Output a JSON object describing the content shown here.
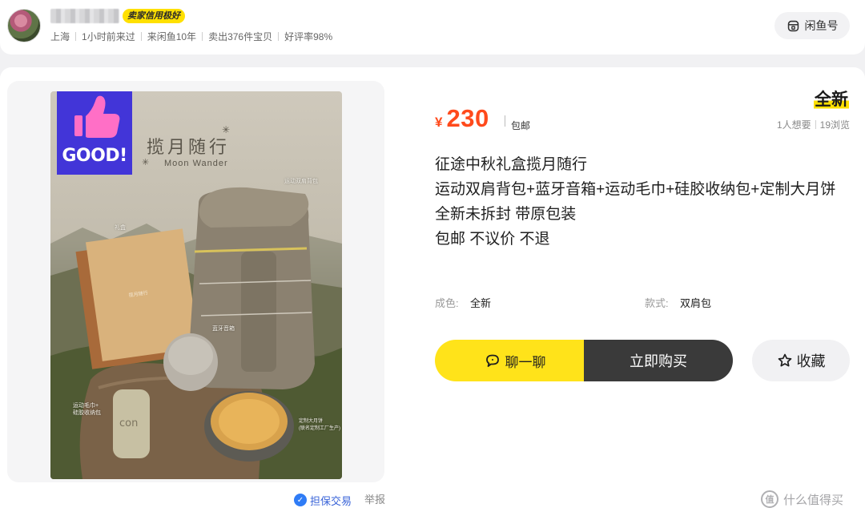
{
  "seller": {
    "credit_badge": "卖家信用极好",
    "location": "上海",
    "last_seen": "1小时前来过",
    "years": "来闲鱼10年",
    "sold": "卖出376件宝贝",
    "rating": "好评率98%",
    "xianyu_button": "闲鱼号"
  },
  "product_image": {
    "badge_text": "GOOD!",
    "title": "揽月随行",
    "subtitle": "Moon Wander",
    "labels": {
      "backpack": "运动双肩背包",
      "gift_box": "礼盒",
      "speaker": "蓝牙音箱",
      "towel": "运动毛巾+\n硅胶收纳包",
      "mooncake": "定制大月饼\n(联名定制工厂生产)"
    }
  },
  "footer_links": {
    "escrow": "担保交易",
    "report": "举报"
  },
  "price": {
    "currency": "¥",
    "amount": "230",
    "shipping": "包邮"
  },
  "condition_tag": "全新",
  "stats": {
    "wants": "1人想要",
    "views": "19浏览"
  },
  "description": [
    "征途中秋礼盒揽月随行",
    "运动双肩背包+蓝牙音箱+运动毛巾+硅胶收纳包+定制大月饼",
    "全新未拆封 带原包装",
    "包邮 不议价 不退"
  ],
  "attributes": {
    "condition_label": "成色:",
    "condition_value": "全新",
    "style_label": "款式:",
    "style_value": "双肩包"
  },
  "actions": {
    "chat": "聊一聊",
    "buy": "立即购买",
    "favorite": "收藏"
  },
  "watermark": {
    "text": "什么值得买",
    "logo": "值"
  },
  "colors": {
    "accent_yellow": "#ffe31a",
    "price_red": "#ff4a1c",
    "buy_dark": "#3a3a3a",
    "link_blue": "#3a64d8"
  }
}
